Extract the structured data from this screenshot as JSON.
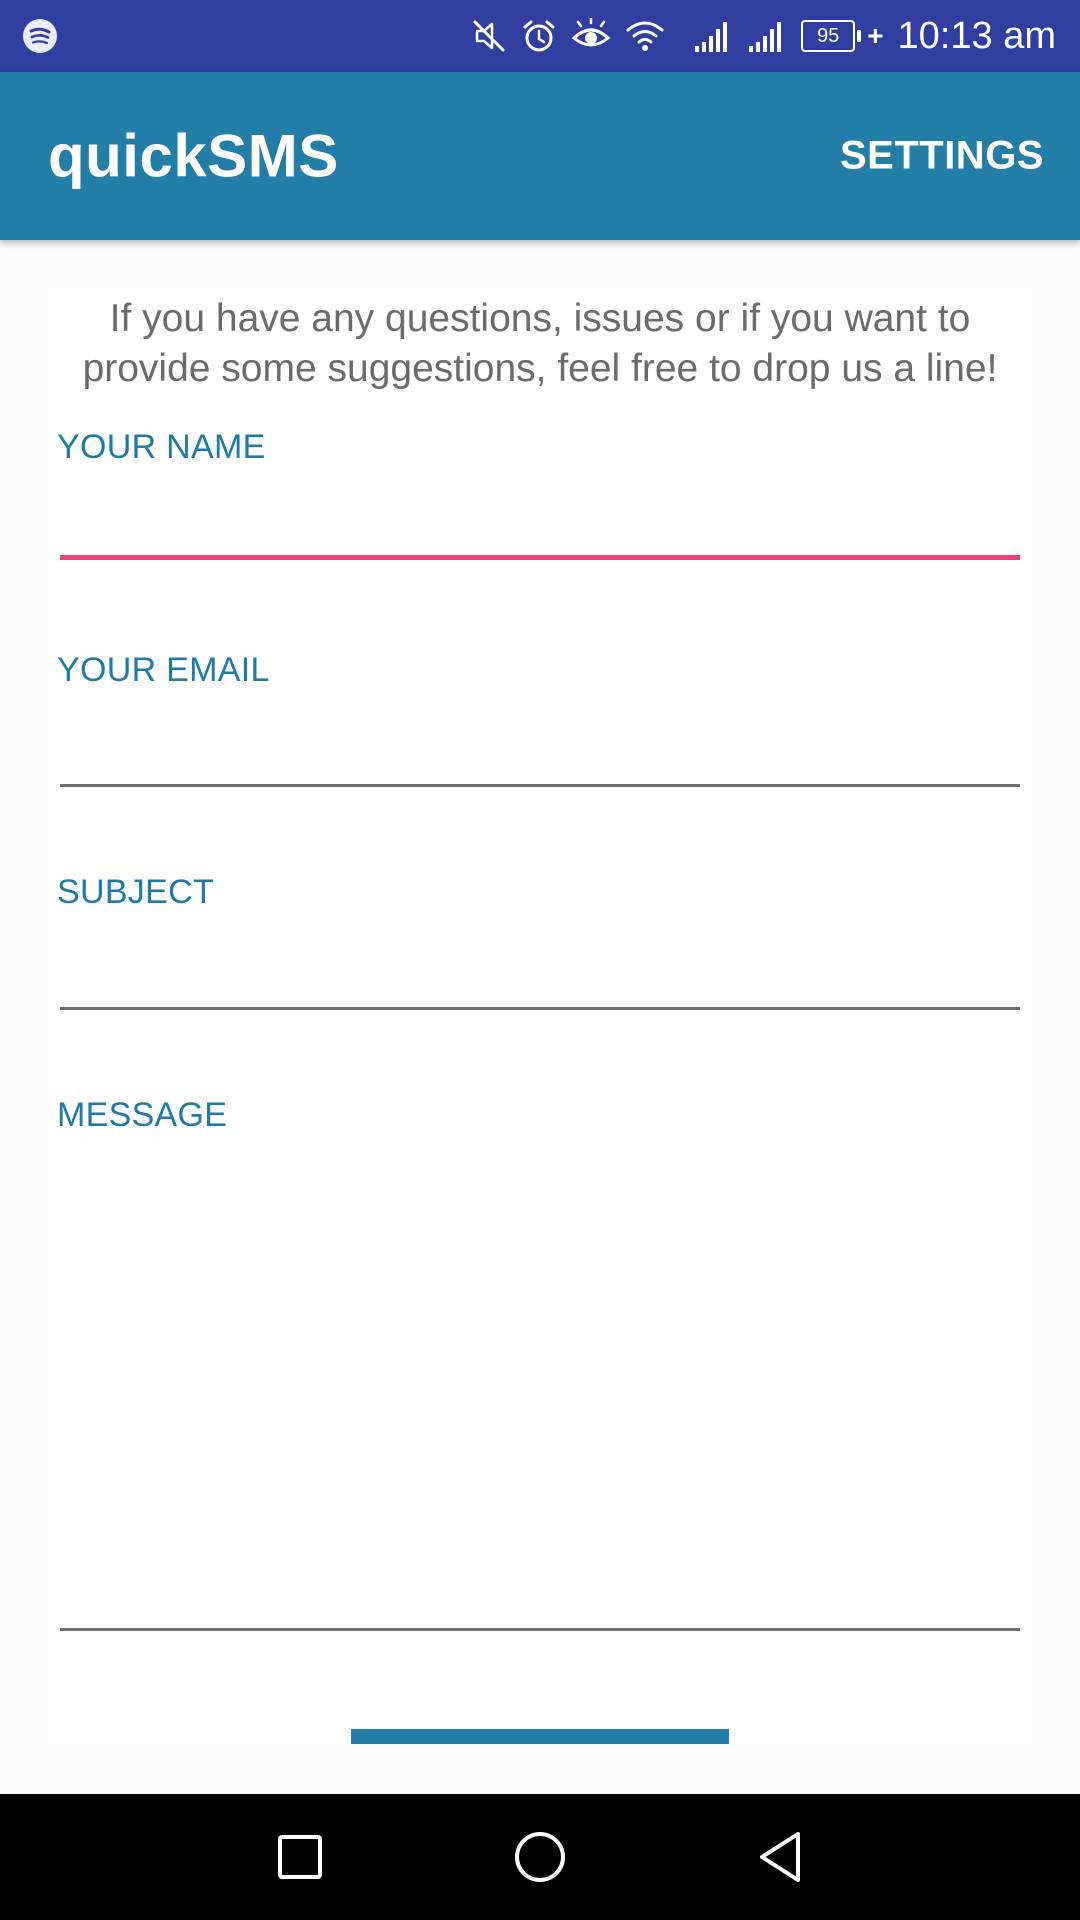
{
  "status_bar": {
    "battery_level": "95",
    "charging_symbol": "+",
    "time": "10:13 am",
    "icons": [
      "spotify-icon",
      "mute-icon",
      "alarm-icon",
      "eye-comfort-icon",
      "wifi-icon",
      "signal-icon",
      "signal-icon",
      "battery-icon"
    ]
  },
  "app_bar": {
    "title": "quickSMS",
    "action_label": "SETTINGS"
  },
  "form": {
    "intro_text": "If you have any questions, issues or if you want to provide some suggestions, feel free to drop us a line!",
    "name": {
      "label": "YOUR NAME",
      "value": ""
    },
    "email": {
      "label": "YOUR EMAIL",
      "value": ""
    },
    "subject": {
      "label": "SUBJECT",
      "value": ""
    },
    "message": {
      "label": "MESSAGE",
      "value": ""
    },
    "focused_field": "name"
  },
  "colors": {
    "status_bar": "#303f9f",
    "app_bar": "#237ea7",
    "label": "#1f7aa6",
    "focus_underline": "#ec407a",
    "underline": "#6f6f6f"
  },
  "nav_bar": {
    "buttons": [
      "recents-icon",
      "home-icon",
      "back-icon"
    ]
  }
}
